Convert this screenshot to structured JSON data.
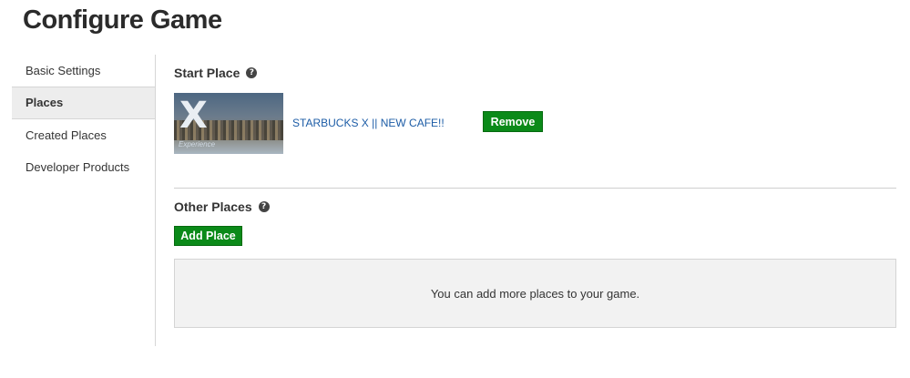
{
  "page": {
    "title": "Configure Game"
  },
  "sidebar": {
    "items": [
      {
        "label": "Basic Settings",
        "active": false
      },
      {
        "label": "Places",
        "active": true
      },
      {
        "label": "Created Places",
        "active": false
      },
      {
        "label": "Developer Products",
        "active": false
      }
    ]
  },
  "start_place": {
    "title": "Start Place",
    "help_icon": "question-circle-icon",
    "place_name": "STARBUCKS X || NEW CAFE!!",
    "thumbnail_caption": "Experience",
    "remove_label": "Remove"
  },
  "other_places": {
    "title": "Other Places",
    "help_icon": "question-circle-icon",
    "add_label": "Add Place",
    "empty_message": "You can add more places to your game."
  },
  "colors": {
    "button_green": "#0b8a19",
    "link_blue": "#1c5ca6",
    "active_nav_bg": "#ededed",
    "empty_box_bg": "#f2f2f2"
  }
}
